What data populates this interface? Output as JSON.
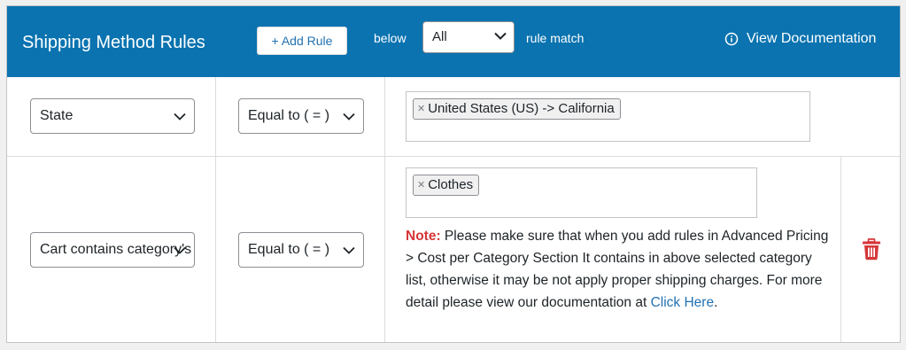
{
  "header": {
    "title": "Shipping Method Rules",
    "add_rule_label": "+ Add Rule",
    "below_label": "below",
    "match_value": "All",
    "rule_match_label": "rule match",
    "doc_label": "View Documentation"
  },
  "rules": [
    {
      "condition": "State",
      "operator": "Equal to ( = )",
      "tags": [
        "United States (US) -> California"
      ]
    },
    {
      "condition": "Cart contains category's product",
      "operator": "Equal to ( = )",
      "tags": [
        "Clothes"
      ],
      "note_label": "Note:",
      "note_text": " Please make sure that when you add rules in Advanced Pricing > Cost per Category Section It contains in above selected category list, otherwise it may be not apply proper shipping charges. For more detail please view our documentation at ",
      "note_link": "Click Here",
      "note_end": "."
    }
  ],
  "colors": {
    "header_bg": "#0a73b0",
    "note_red": "#d63638",
    "link_blue": "#2271b1",
    "trash_red": "#d63638"
  },
  "icons": {
    "info": "info-circle-icon",
    "chevron": "chevron-down-icon",
    "remove": "tag-remove-icon",
    "trash": "trash-icon"
  }
}
